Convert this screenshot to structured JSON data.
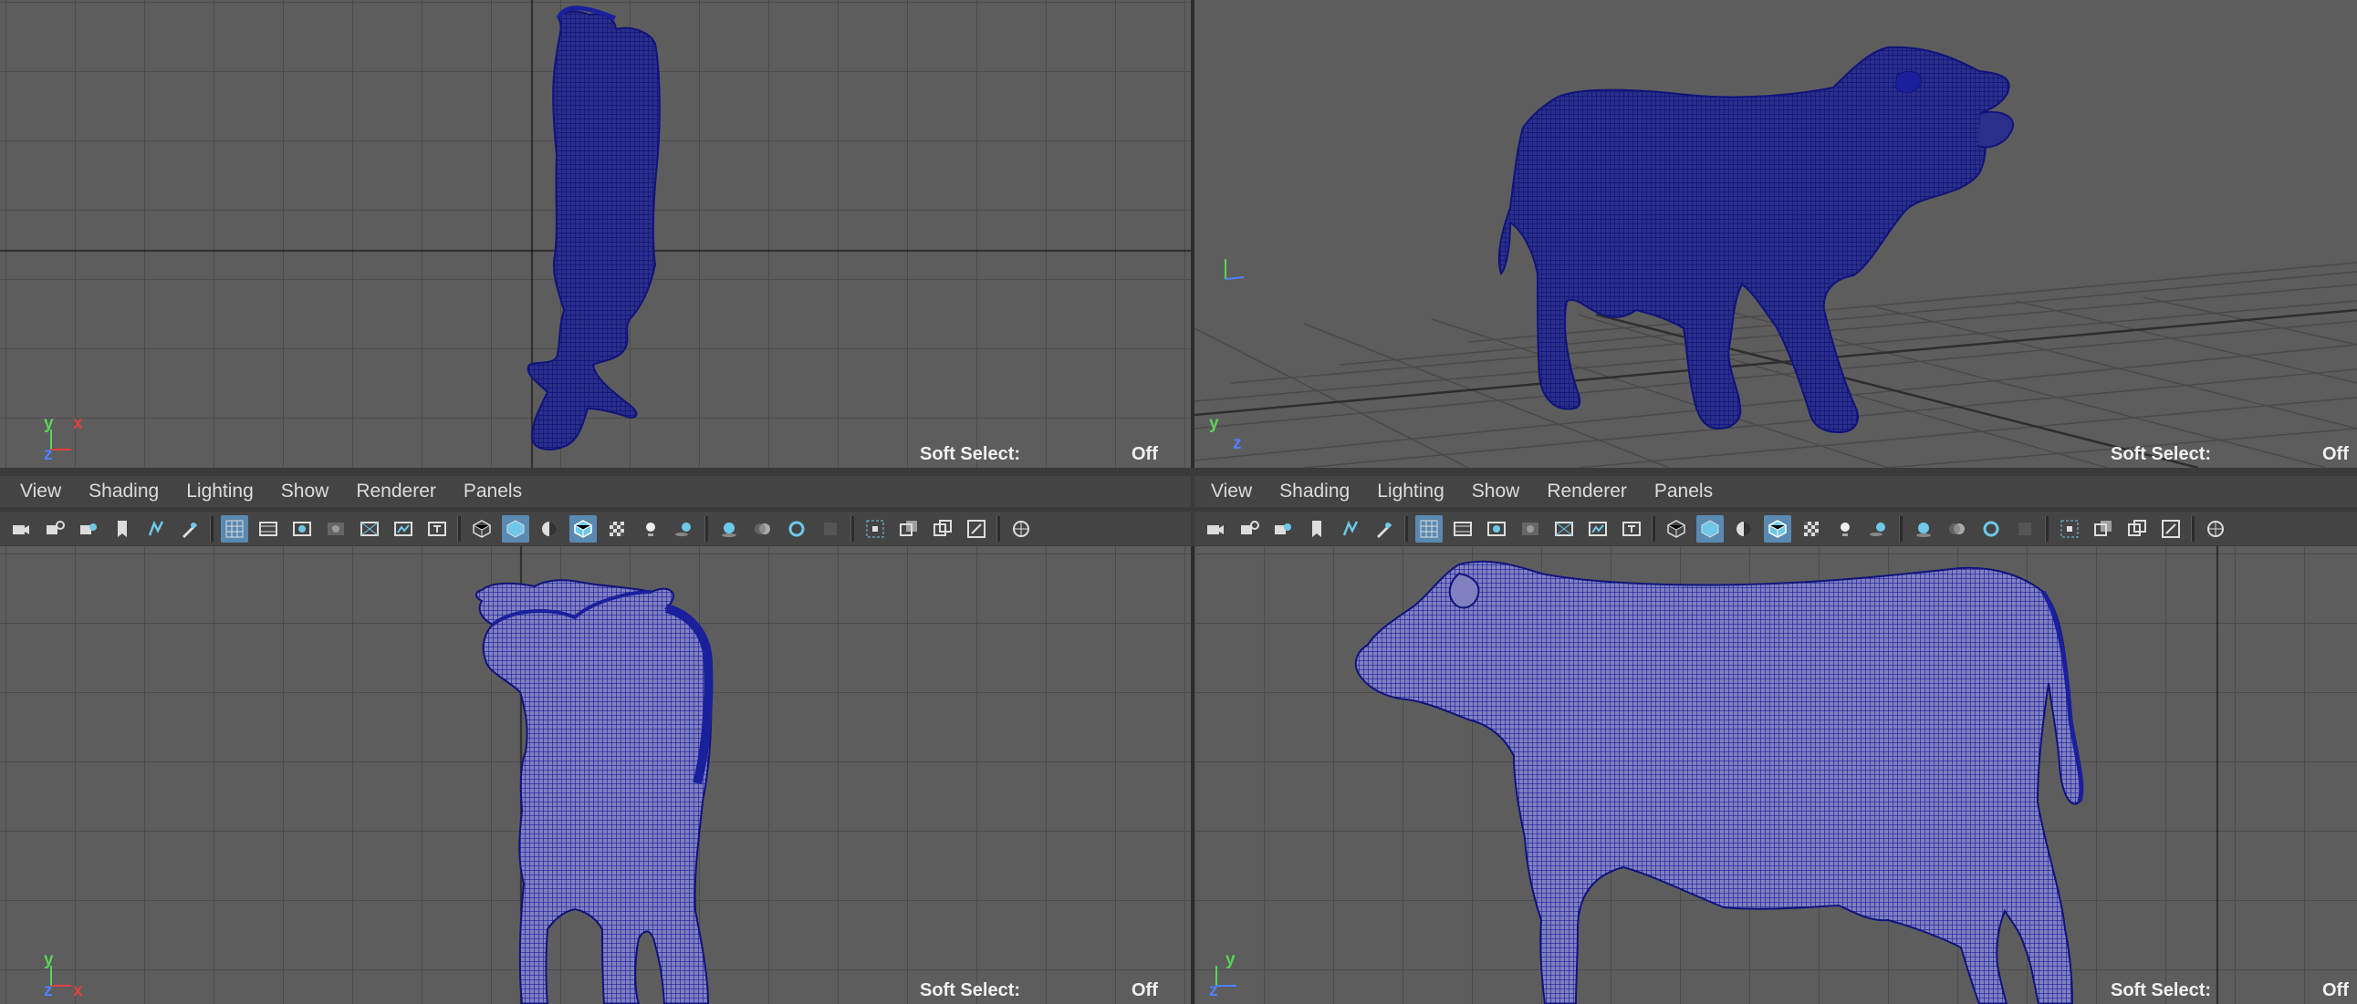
{
  "colors": {
    "viewport_bg": "#5d5d5d",
    "mesh_blue": "#1a1f9c",
    "panel_bg": "#444444",
    "active_icon_bg": "#5a89b1"
  },
  "menu": [
    "View",
    "Shading",
    "Lighting",
    "Show",
    "Renderer",
    "Panels"
  ],
  "toolbar_icons": [
    "select-camera-icon",
    "camera-attributes-icon",
    "bookmarks-icon",
    "image-plane-icon",
    "2d-pan-zoom-icon",
    "grease-pencil-icon",
    "separator",
    "grid-icon",
    "film-gate-icon",
    "resolution-gate-icon",
    "gate-mask-icon",
    "field-chart-icon",
    "safe-action-icon",
    "safe-title-icon",
    "separator",
    "wireframe-icon",
    "smooth-shade-icon",
    "use-default-material-icon",
    "wireframe-on-shaded-icon",
    "textured-icon",
    "use-all-lights-icon",
    "shadows-icon",
    "separator",
    "screen-space-ao-icon",
    "motion-blur-icon",
    "multisample-aa-icon",
    "depth-of-field-icon",
    "separator",
    "isolate-select-icon",
    "xray-icon",
    "xray-joints-icon",
    "xray-components-icon",
    "separator",
    "exposure-icon"
  ],
  "viewports": {
    "top": {
      "soft_select_label": "Soft Select:",
      "soft_select_value": "Off",
      "axes": [
        "y",
        "x",
        "z"
      ]
    },
    "persp": {
      "soft_select_label": "Soft Select:",
      "soft_select_value": "Off",
      "axes": [
        "y",
        "z"
      ]
    },
    "front": {
      "soft_select_label": "Soft Select:",
      "soft_select_value": "Off",
      "axes": [
        "y",
        "z",
        "x"
      ]
    },
    "side": {
      "soft_select_label": "Soft Select:",
      "soft_select_value": "Off",
      "axes": [
        "y",
        "z"
      ]
    }
  }
}
